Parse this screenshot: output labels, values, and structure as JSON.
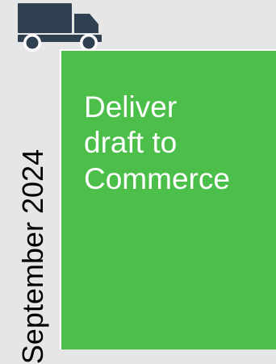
{
  "timeline": {
    "date_label": "September 2024"
  },
  "milestone": {
    "text": "Deliver\ndraft to\nCommerce",
    "icon": "truck-icon",
    "colors": {
      "card": "#4cbf4a",
      "icon": "#2f4050",
      "background": "#e6e6e7",
      "text": "#ffffff"
    }
  }
}
